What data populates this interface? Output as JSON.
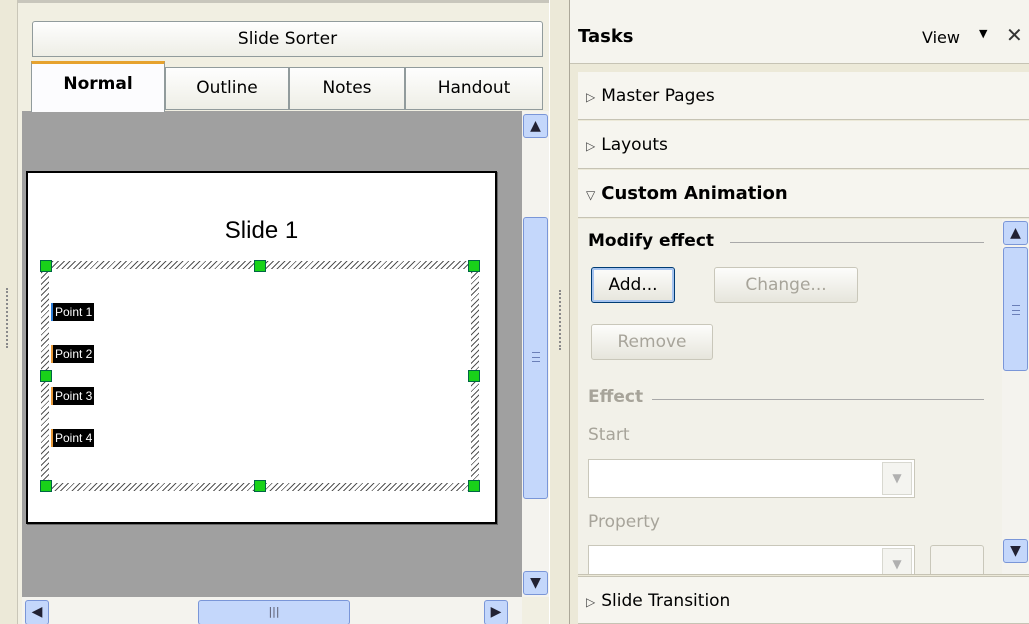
{
  "view_tabs": {
    "slide_sorter": "Slide Sorter",
    "normal": "Normal",
    "outline": "Outline",
    "notes": "Notes",
    "handout": "Handout",
    "active": "Normal"
  },
  "slide": {
    "title": "Slide 1",
    "bullets": [
      "Point 1",
      "Point 2",
      "Point 3",
      "Point 4"
    ]
  },
  "task_pane": {
    "title": "Tasks",
    "view_menu": "View",
    "sections": {
      "master_pages": "Master Pages",
      "layouts": "Layouts",
      "custom_animation": "Custom Animation",
      "slide_transition": "Slide Transition"
    },
    "custom_animation": {
      "modify_effect_label": "Modify effect",
      "add_button": "Add...",
      "change_button": "Change...",
      "remove_button": "Remove",
      "effect_label": "Effect",
      "start_label": "Start",
      "property_label": "Property"
    }
  },
  "icons": {
    "expand": "triangle-right",
    "collapse": "triangle-down",
    "close": "close-icon"
  }
}
